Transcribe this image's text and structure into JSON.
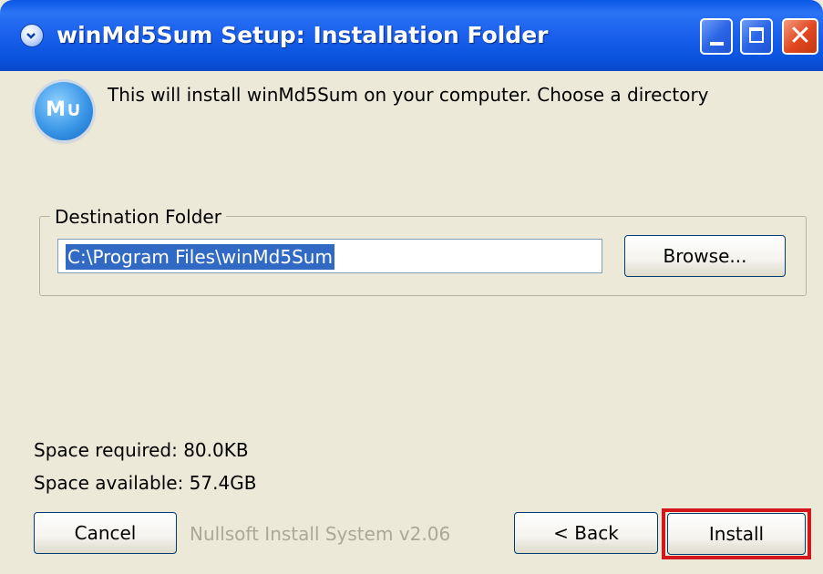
{
  "window": {
    "title": "winMd5Sum Setup: Installation Folder",
    "controls": {
      "minimize_icon": "minimize-icon",
      "maximize_icon": "maximize-icon",
      "close_icon": "close-icon",
      "close_glyph": "✕"
    }
  },
  "header": {
    "logo_text": "M∪",
    "intro_text": "This will install winMd5Sum on your computer. Choose a directory"
  },
  "destination": {
    "group_label": "Destination Folder",
    "path_value": "C:\\Program Files\\winMd5Sum",
    "browse_label": "Browse..."
  },
  "space": {
    "required": "Space required: 80.0KB",
    "available": "Space available: 57.4GB"
  },
  "footer": {
    "branding": "Nullsoft Install System v2.06",
    "cancel_label": "Cancel",
    "back_label": "< Back",
    "install_label": "Install"
  },
  "colors": {
    "titlebar": "#0a56e5",
    "dialog_bg": "#ece9d8",
    "selection": "#316ac5",
    "highlight_border": "#d3171c"
  }
}
